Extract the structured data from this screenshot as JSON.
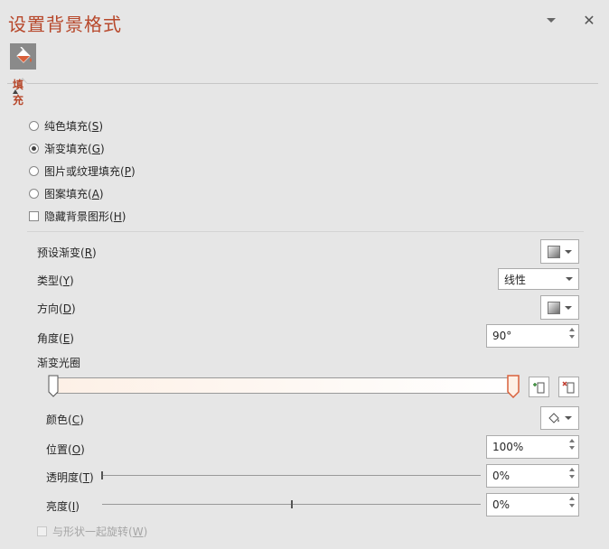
{
  "panel": {
    "title": "设置背景格式",
    "section_title": "填充"
  },
  "fill_options": [
    {
      "label": "纯色填充(",
      "key": "S",
      "end": ")",
      "selected": false
    },
    {
      "label": "渐变填充(",
      "key": "G",
      "end": ")",
      "selected": true
    },
    {
      "label": "图片或纹理填充(",
      "key": "P",
      "end": ")",
      "selected": false
    },
    {
      "label": "图案填充(",
      "key": "A",
      "end": ")",
      "selected": false
    }
  ],
  "hide_bg": {
    "label": "隐藏背景图形(",
    "key": "H",
    "end": ")",
    "checked": false
  },
  "preset": {
    "label": "预设渐变(",
    "key": "R",
    "end": ")"
  },
  "type": {
    "label": "类型(",
    "key": "Y",
    "end": ")",
    "value": "线性"
  },
  "direction": {
    "label": "方向(",
    "key": "D",
    "end": ")"
  },
  "angle": {
    "label": "角度(",
    "key": "E",
    "end": ")",
    "value": "90°"
  },
  "gradient_stops": {
    "label": "渐变光圈"
  },
  "color": {
    "label": "颜色(",
    "key": "C",
    "end": ")"
  },
  "position": {
    "label": "位置(",
    "key": "O",
    "end": ")",
    "value": "100%"
  },
  "transparency": {
    "label": "透明度(",
    "key": "T",
    "end": ")",
    "value": "0%",
    "level": 0
  },
  "brightness": {
    "label": "亮度(",
    "key": "I",
    "end": ")",
    "value": "0%",
    "level": 0.5
  },
  "rotate": {
    "label": "与形状一起旋转(",
    "key": "W",
    "end": ")",
    "checked": false,
    "disabled": true
  },
  "colors": {
    "accent": "#b7472a",
    "panel_bg": "#e6e6e6"
  }
}
